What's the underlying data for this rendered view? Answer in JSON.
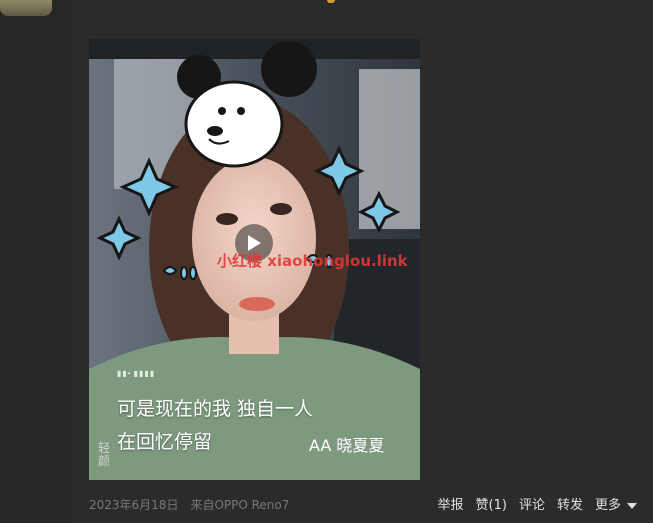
{
  "post": {
    "video": {
      "caption_line1": "可是现在的我 独自一人",
      "caption_line2": "在回忆停留",
      "signature": "AA 晓夏夏",
      "watermark": "小红楼 xiaohonglou.link",
      "corner_logo": "轻颜",
      "audio_wave": "▮▮╸▮▮▮▮"
    },
    "meta": {
      "date_source": "2023年6月18日　来自OPPO Reno7"
    },
    "actions": {
      "report": "举报",
      "like": "赞(1)",
      "comment": "评论",
      "share": "转发",
      "more": "更多"
    }
  },
  "colors": {
    "background": "#2b2b2b",
    "sidebar": "#262626",
    "watermark": "#e13737"
  }
}
